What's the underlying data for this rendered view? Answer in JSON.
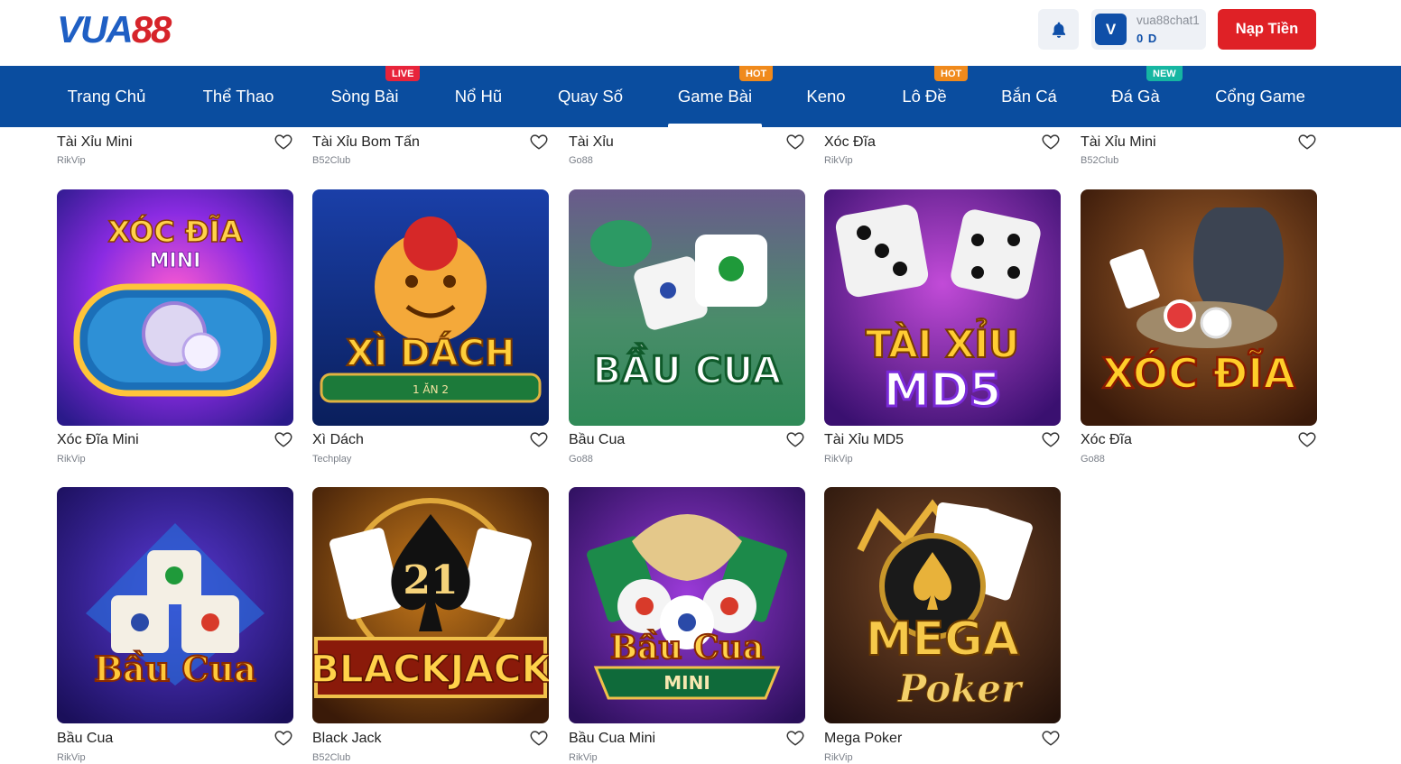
{
  "header": {
    "logo_text_a": "VUA",
    "logo_text_b": "88",
    "user": {
      "avatar_letter": "V",
      "username": "vua88chat1",
      "balance": "0 D"
    },
    "deposit_label": "Nạp Tiền"
  },
  "nav": {
    "items": [
      {
        "label": "Trang Chủ",
        "badge": ""
      },
      {
        "label": "Thể Thao",
        "badge": ""
      },
      {
        "label": "Sòng Bài",
        "badge": "LIVE"
      },
      {
        "label": "Nổ Hũ",
        "badge": ""
      },
      {
        "label": "Quay Số",
        "badge": ""
      },
      {
        "label": "Game Bài",
        "badge": "HOT"
      },
      {
        "label": "Keno",
        "badge": ""
      },
      {
        "label": "Lô Đề",
        "badge": "HOT"
      },
      {
        "label": "Bắn Cá",
        "badge": ""
      },
      {
        "label": "Đá Gà",
        "badge": "NEW"
      },
      {
        "label": "Cổng Game",
        "badge": ""
      }
    ],
    "active_index": 5,
    "badge_colors": {
      "LIVE": "#e8243b",
      "HOT": "#f08a1c",
      "NEW": "#16b6a2"
    }
  },
  "games": {
    "row0": [
      {
        "title": "Tài Xỉu Mini",
        "provider": "RikVip"
      },
      {
        "title": "Tài Xỉu Bom Tấn",
        "provider": "B52Club"
      },
      {
        "title": "Tài Xỉu",
        "provider": "Go88"
      },
      {
        "title": "Xóc Đĩa",
        "provider": "RikVip"
      },
      {
        "title": "Tài Xỉu Mini",
        "provider": "B52Club"
      }
    ],
    "row1": [
      {
        "title": "Xóc Đĩa Mini",
        "provider": "RikVip",
        "art_text": "XÓC ĐĨA",
        "art_sub": "MINI"
      },
      {
        "title": "Xì Dách",
        "provider": "Techplay",
        "art_text": "XÌ DÁCH",
        "art_sub": "1 ĂN 2"
      },
      {
        "title": "Bầu Cua",
        "provider": "Go88",
        "art_text": "BẦU CUA",
        "art_sub": ""
      },
      {
        "title": "Tài Xỉu MD5",
        "provider": "RikVip",
        "art_text": "TÀI XỈU",
        "art_sub": "MD5"
      },
      {
        "title": "Xóc Đĩa",
        "provider": "Go88",
        "art_text": "XÓC ĐĨA",
        "art_sub": ""
      }
    ],
    "row2": [
      {
        "title": "Bầu Cua",
        "provider": "RikVip",
        "art_text": "Bầu Cua",
        "art_sub": ""
      },
      {
        "title": "Black Jack",
        "provider": "B52Club",
        "art_text": "BLACKJACK",
        "art_sub": "21"
      },
      {
        "title": "Bầu Cua Mini",
        "provider": "RikVip",
        "art_text": "Bầu Cua",
        "art_sub": "MINI"
      },
      {
        "title": "Mega Poker",
        "provider": "RikVip",
        "art_text": "MEGA",
        "art_sub": "Poker"
      }
    ]
  }
}
